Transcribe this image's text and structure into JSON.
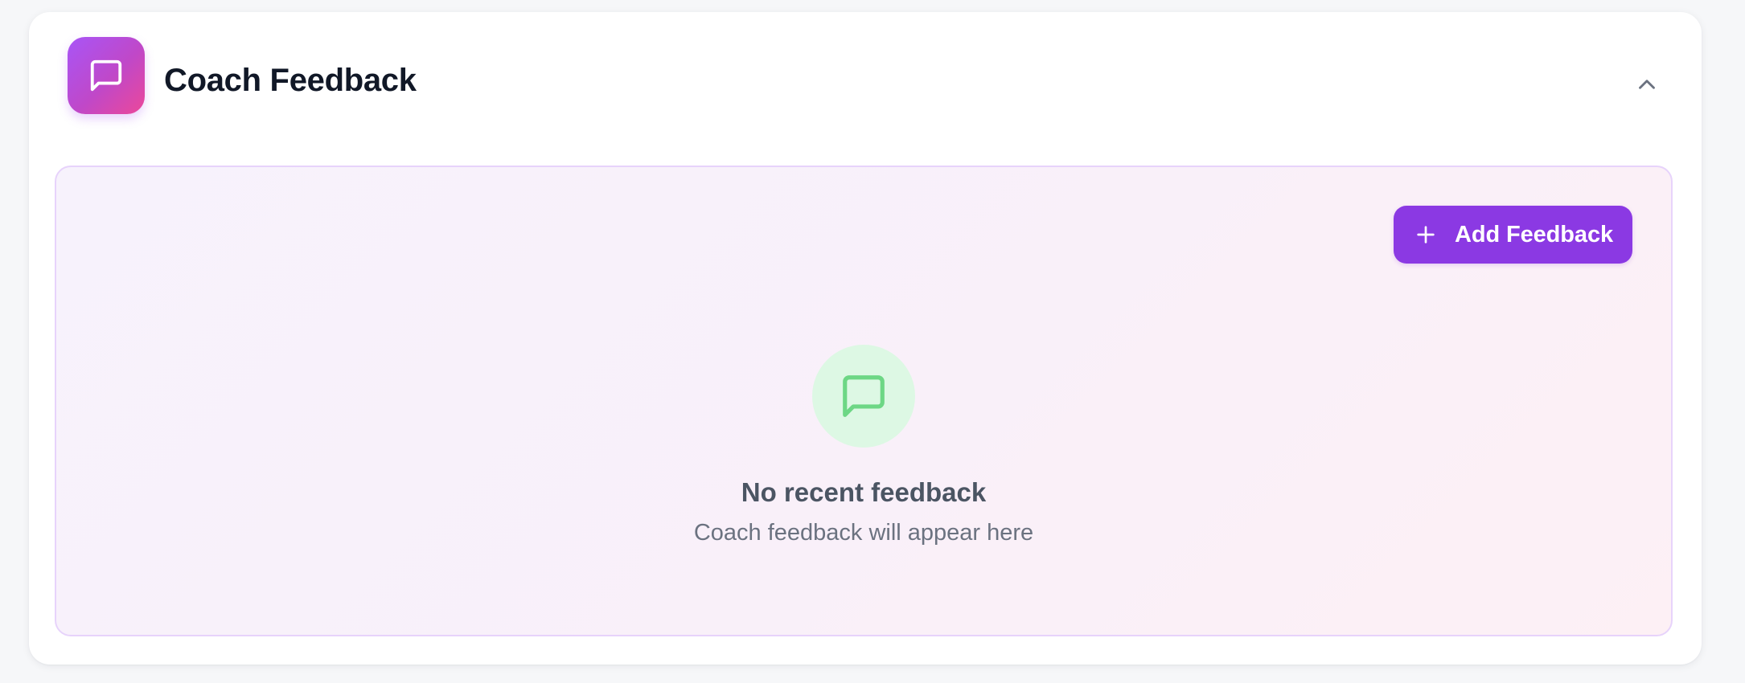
{
  "section": {
    "title": "Coach Feedback",
    "header_icon": "message-square-icon",
    "collapse_icon": "chevron-up-icon"
  },
  "actions": {
    "add_feedback_label": "Add Feedback",
    "add_icon": "plus-icon"
  },
  "empty_state": {
    "icon": "message-square-icon",
    "title": "No recent feedback",
    "subtitle": "Coach feedback will appear here"
  },
  "colors": {
    "accent": "#8b39e3",
    "header_icon_gradient_start": "#a855f7",
    "header_icon_gradient_end": "#ec4899",
    "empty_icon_background": "#ddf8e4",
    "empty_icon_stroke": "#6dd785",
    "panel_border": "#e7d3fb",
    "title_text": "#111827"
  }
}
